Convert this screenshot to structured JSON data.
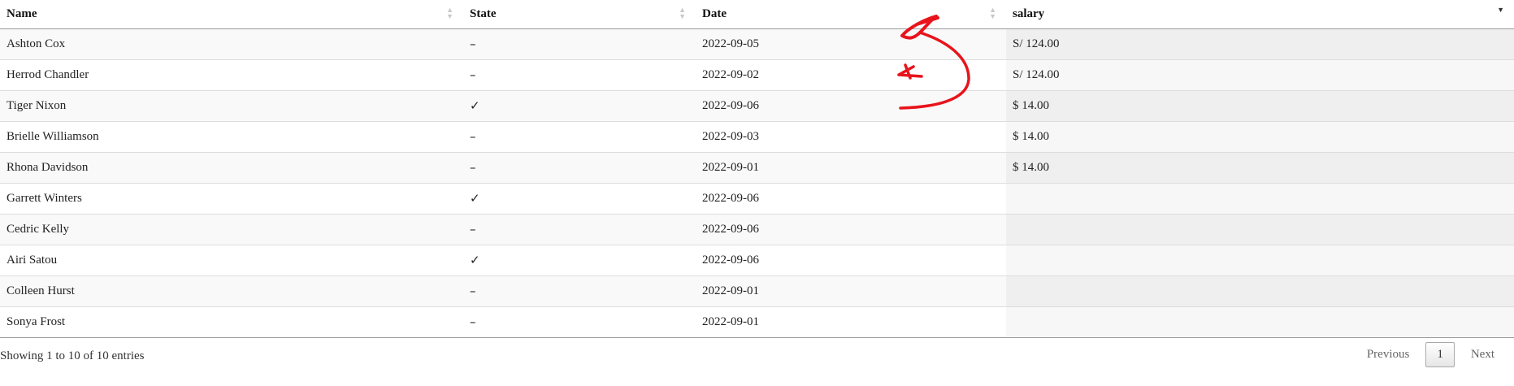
{
  "table": {
    "columns": [
      {
        "label": "Name"
      },
      {
        "label": "State"
      },
      {
        "label": "Date"
      },
      {
        "label": "salary"
      }
    ],
    "sorted_column": "salary",
    "rows": [
      {
        "name": "Ashton Cox",
        "state": "–",
        "date": "2022-09-05",
        "salary": "S/ 124.00"
      },
      {
        "name": "Herrod Chandler",
        "state": "–",
        "date": "2022-09-02",
        "salary": "S/ 124.00"
      },
      {
        "name": "Tiger Nixon",
        "state": "✓",
        "date": "2022-09-06",
        "salary": "$ 14.00"
      },
      {
        "name": "Brielle Williamson",
        "state": "–",
        "date": "2022-09-03",
        "salary": "$ 14.00"
      },
      {
        "name": "Rhona Davidson",
        "state": "–",
        "date": "2022-09-01",
        "salary": "$ 14.00"
      },
      {
        "name": "Garrett Winters",
        "state": "✓",
        "date": "2022-09-06",
        "salary": ""
      },
      {
        "name": "Cedric Kelly",
        "state": "–",
        "date": "2022-09-06",
        "salary": ""
      },
      {
        "name": "Airi Satou",
        "state": "✓",
        "date": "2022-09-06",
        "salary": ""
      },
      {
        "name": "Colleen Hurst",
        "state": "–",
        "date": "2022-09-01",
        "salary": ""
      },
      {
        "name": "Sonya Frost",
        "state": "–",
        "date": "2022-09-01",
        "salary": ""
      }
    ]
  },
  "footer": {
    "info": "Showing 1 to 10 of 10 entries",
    "previous_label": "Previous",
    "current_page": "1",
    "next_label": "Next"
  },
  "colors": {
    "annotation": "#e8141c"
  }
}
